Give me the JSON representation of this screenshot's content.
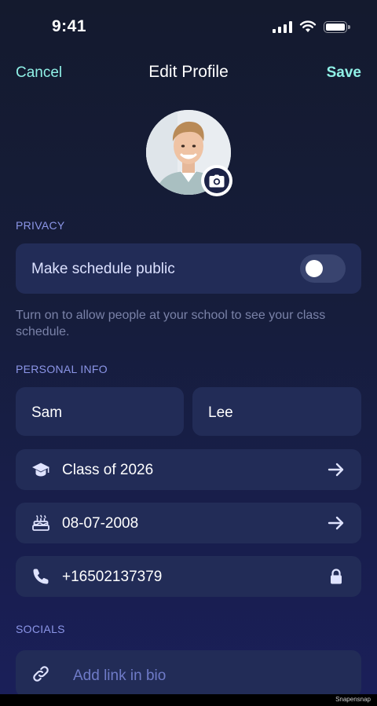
{
  "status_bar": {
    "time": "9:41"
  },
  "nav": {
    "cancel_label": "Cancel",
    "title": "Edit Profile",
    "save_label": "Save"
  },
  "avatar": {
    "camera_icon": "camera-icon"
  },
  "privacy": {
    "section_label": "PRIVACY",
    "toggle_label": "Make schedule public",
    "toggle_on": false,
    "helper_text": "Turn on to allow people at your school to see your class schedule."
  },
  "personal_info": {
    "section_label": "PERSONAL INFO",
    "first_name": "Sam",
    "last_name": "Lee",
    "class_year": "Class of 2026",
    "birthday": "08-07-2008",
    "phone": "+16502137379"
  },
  "socials": {
    "section_label": "SOCIALS",
    "link_placeholder": "Add link in bio"
  },
  "footer": {
    "watermark": "Snapensnap"
  },
  "colors": {
    "accent": "#8ff0e6",
    "section_label": "#8c96e8",
    "card_bg": "#222c57"
  }
}
